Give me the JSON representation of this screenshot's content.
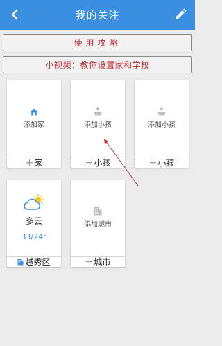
{
  "header": {
    "title": "我的关注",
    "back_icon": "chevron-left-icon",
    "edit_icon": "pencil-icon"
  },
  "banners": {
    "guide_label": "使用攻略",
    "video_label": "小视频：教你设置家和学校"
  },
  "cards": {
    "home": {
      "label": "添加家",
      "footer": "家",
      "icon": "house-icon"
    },
    "child1": {
      "label": "添加小孩",
      "footer": "小孩",
      "icon": "child-icon"
    },
    "child2": {
      "label": "添加小孩",
      "footer": "小孩",
      "icon": "child-icon"
    },
    "weather": {
      "condition": "多云",
      "temperature": "33/24°",
      "location": "越秀区",
      "icon": "partly-cloudy-icon",
      "location_icon": "building-icon"
    },
    "city": {
      "label": "添加城市",
      "footer": "城市",
      "icon": "building-icon"
    }
  },
  "colors": {
    "header_bg": "#3b8fe0",
    "banner_text": "#c0272d",
    "accent": "#3b8fe0",
    "arrow": "#c0272d"
  }
}
